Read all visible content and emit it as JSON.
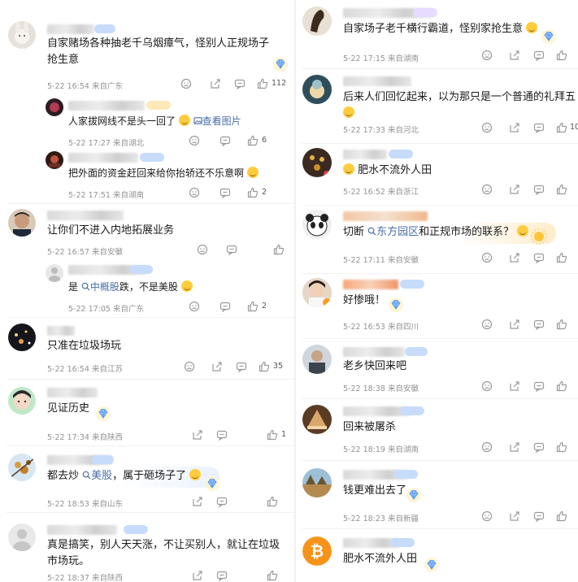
{
  "left": {
    "comments": [
      {
        "text": "自家赌场各种抽老千乌烟瘴气，怪别人正规场子抢生意",
        "meta": "5-22 16:54  来自广东",
        "likes": "112",
        "replies": [
          {
            "text_before": "人家拔网线不是头一回了",
            "link": "查看图片",
            "meta": "5-22 17:27  来自湖北",
            "likes": "6"
          },
          {
            "text": "把外面的资金赶回来给你抬轿还不乐意啊",
            "meta": "5-22 17:51  来自湖南",
            "likes": "2"
          }
        ]
      },
      {
        "text": "让你们不进入内地拓展业务",
        "meta": "5-22 16:57  来自安徽",
        "likes": "",
        "replies": [
          {
            "text_before": "是 ",
            "link": "中概股",
            "text_after": "跌，不是美股",
            "meta": "5-22 17:05  来自广东",
            "likes": "2"
          }
        ]
      },
      {
        "text": "只准在垃圾场玩",
        "meta": "5-22 16:54  来自江苏",
        "likes": "35"
      },
      {
        "text": "见证历史",
        "meta": "5-22 17:34  来自陕西",
        "likes": "1"
      },
      {
        "text_before": "都去炒 ",
        "link": "美股",
        "text_after": "，属于砸场子了",
        "meta": "5-22 18:53  来自山东",
        "likes": ""
      },
      {
        "text": "真是搞笑，别人天天涨，不让买别人，就让在垃圾市场玩。",
        "meta": "5-22 18:37  来自陕西",
        "likes": ""
      }
    ]
  },
  "right": {
    "comments": [
      {
        "text": "自家场子老千横行霸道，怪别家抢生意",
        "meta": "5-22 17:15  来自湖南",
        "likes": ""
      },
      {
        "text": "后来人们回忆起来，以为那只是一个普通的礼拜五",
        "meta": "5-22 17:33  来自河北",
        "likes": "10"
      },
      {
        "text": "肥水不流外人田",
        "meta": "5-22 16:52  来自浙江",
        "likes": ""
      },
      {
        "text_before": "切断 ",
        "link": "东方园区",
        "text_after": "和正规市场的联系？",
        "meta": "5-22 17:11  来自安徽",
        "likes": ""
      },
      {
        "text": "好惨哦！",
        "meta": "5-22 16:53  来自四川",
        "likes": ""
      },
      {
        "text": "老乡快回来吧",
        "meta": "5-22 18:38  来自安徽",
        "likes": ""
      },
      {
        "text": "回来被屠杀",
        "meta": "5-22 18:19  来自湖南",
        "likes": ""
      },
      {
        "text": "钱更难出去了",
        "meta": "5-22 18:23  来自新疆",
        "likes": ""
      },
      {
        "text": "肥水不流外人田",
        "meta": "",
        "likes": ""
      }
    ]
  },
  "colors": {
    "link": "#4a6ea8",
    "meta": "#939393",
    "fan_badge": "#3f7fe6",
    "divider": "#f0f0f0"
  },
  "icons": [
    "dislike-icon",
    "share-icon",
    "reply-icon",
    "like-icon",
    "search-icon",
    "image-icon",
    "diamond-badge-icon"
  ]
}
